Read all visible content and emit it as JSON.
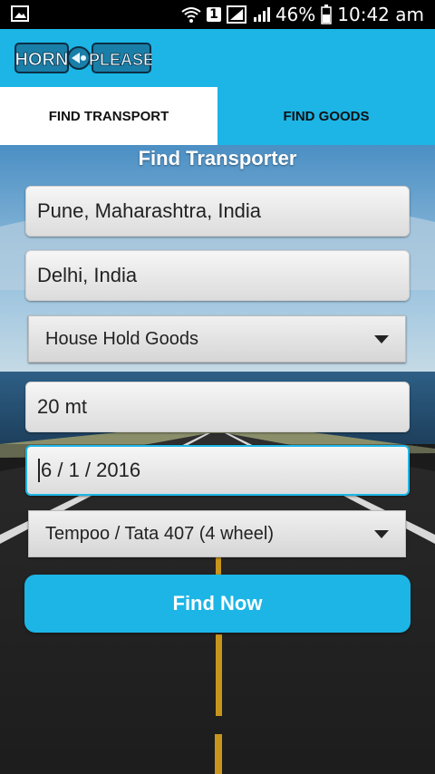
{
  "status_bar": {
    "battery": "46%",
    "time": "10:42 am",
    "sim": "1"
  },
  "app": {
    "logo_left": "HORN",
    "logo_right": "PLEASE"
  },
  "tabs": [
    {
      "label": "FIND TRANSPORT",
      "active": true
    },
    {
      "label": "FIND GOODS",
      "active": false
    }
  ],
  "form": {
    "title": "Find Transporter",
    "from": "Pune, Maharashtra, India",
    "to": "Delhi, India",
    "goods_type": "House Hold Goods",
    "weight": "20 mt",
    "date": "6 / 1 / 2016",
    "vehicle": "Tempoo / Tata 407 (4 wheel)",
    "submit_label": "Find Now"
  },
  "colors": {
    "accent": "#1cb5e6",
    "status_bar": "#000000",
    "tab_active": "#ffffff"
  }
}
